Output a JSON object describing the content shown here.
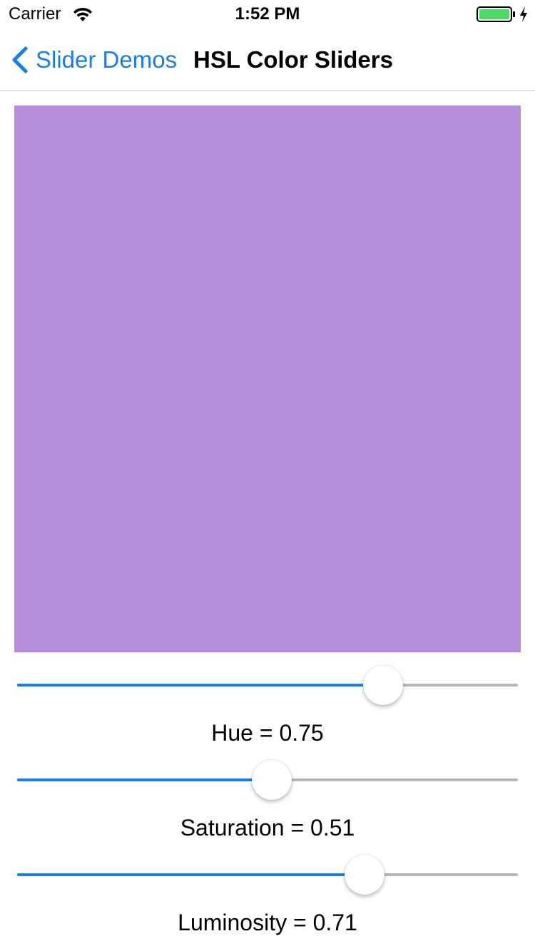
{
  "status_bar": {
    "carrier": "Carrier",
    "time": "1:52 PM",
    "battery_color": "#4cd964"
  },
  "nav": {
    "back_label": "Slider Demos",
    "title": "HSL Color Sliders"
  },
  "preview": {
    "color": "#b68ddb"
  },
  "accent_color": "#1a7fe8",
  "sliders": [
    {
      "name": "hue",
      "label": "Hue = 0.75",
      "value": 0.75
    },
    {
      "name": "saturation",
      "label": "Saturation = 0.51",
      "value": 0.51
    },
    {
      "name": "luminosity",
      "label": "Luminosity = 0.71",
      "value": 0.71
    }
  ]
}
